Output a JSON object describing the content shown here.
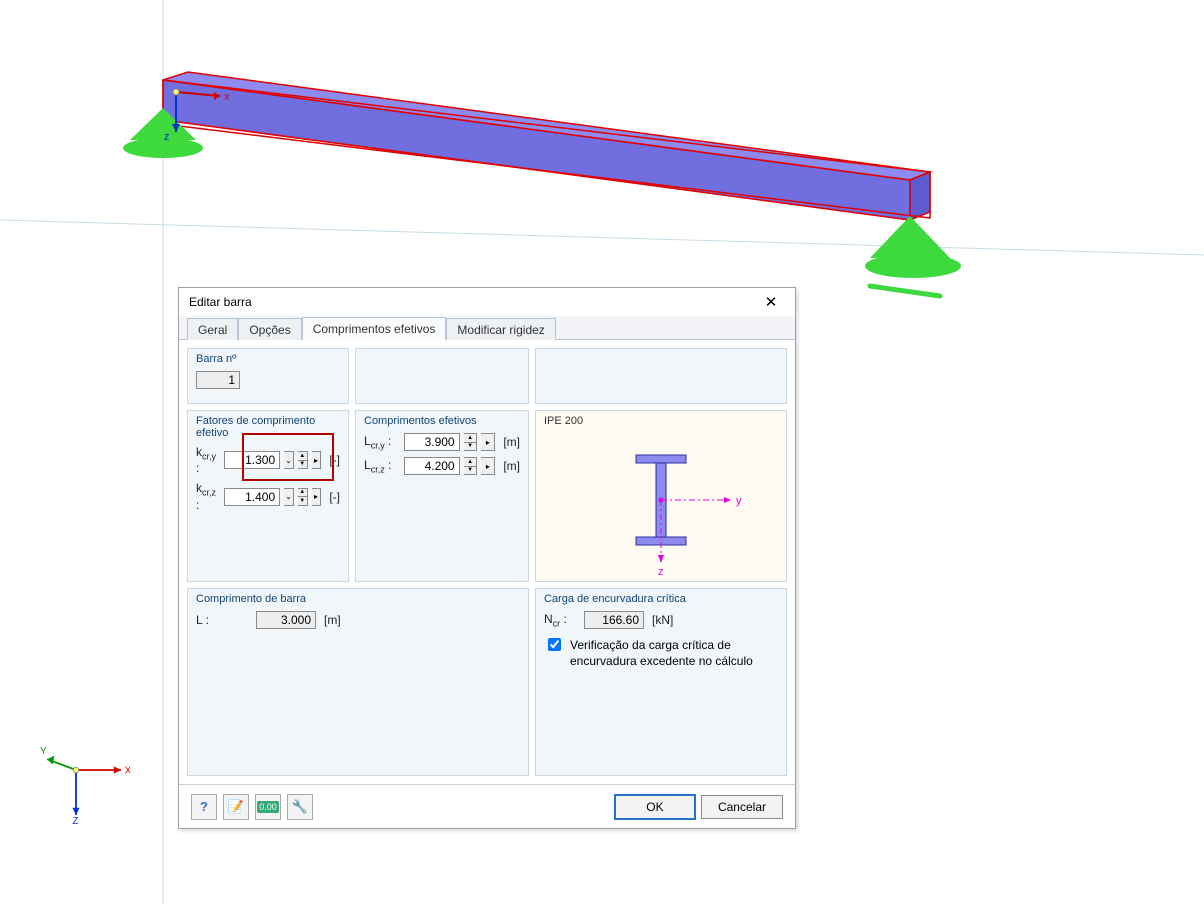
{
  "dialog": {
    "title": "Editar barra",
    "tabs": [
      "Geral",
      "Opções",
      "Comprimentos efetivos",
      "Modificar rigidez"
    ],
    "active_tab": 2,
    "barra_no": {
      "legend": "Barra nº",
      "value": "1"
    },
    "fatores": {
      "legend": "Fatores de comprimento efetivo",
      "rows": [
        {
          "label": "kcr,y :",
          "value": "1.300",
          "unit": "[-]"
        },
        {
          "label": "kcr,z :",
          "value": "1.400",
          "unit": "[-]"
        }
      ]
    },
    "compr": {
      "legend": "Comprimentos efetivos",
      "rows": [
        {
          "label": "Lcr,y :",
          "value": "3.900",
          "unit": "[m]"
        },
        {
          "label": "Lcr,z :",
          "value": "4.200",
          "unit": "[m]"
        }
      ]
    },
    "profile": {
      "legend": "IPE 200",
      "axis_y": "y",
      "axis_z": "z"
    },
    "compr_barra": {
      "legend": "Comprimento de barra",
      "label": "L :",
      "value": "3.000",
      "unit": "[m]"
    },
    "carga": {
      "legend": "Carga de encurvadura crítica",
      "label": "Ncr :",
      "value": "166.60",
      "unit": "[kN]",
      "check_label": "Verificação da carga crítica de encurvadura excedente no cálculo",
      "checked": true
    },
    "buttons": {
      "ok": "OK",
      "cancel": "Cancelar"
    }
  },
  "axes3d": {
    "x": "X",
    "y": "Y",
    "z": "Z"
  }
}
